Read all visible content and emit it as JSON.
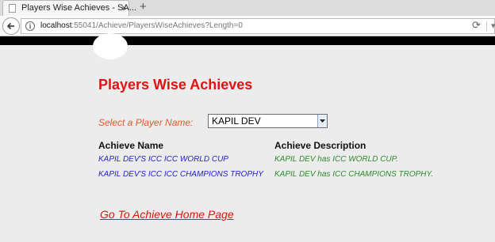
{
  "browser": {
    "tab_title": "Players Wise Achieves - SA...",
    "tab_close": "×",
    "new_tab": "+",
    "url_host": "localhost",
    "url_path": ":55041/Achieve/PlayersWiseAchieves?Length=0",
    "reload_icon": "⟳",
    "more_icon": "▾"
  },
  "page": {
    "title": "Players Wise Achieves",
    "select_label": "Select a Player Name:",
    "selected_player": "KAPIL DEV",
    "columns": [
      "Achieve Name",
      "Achieve Description"
    ],
    "rows": [
      {
        "name": "KAPIL DEV'S ICC ICC WORLD CUP",
        "description": "KAPIL DEV has ICC WORLD CUP."
      },
      {
        "name": "KAPIL DEV'S ICC ICC CHAMPIONS TROPHY",
        "description": "KAPIL DEV has ICC CHAMPIONS TROPHY."
      }
    ],
    "home_link": "Go To Achieve Home Page"
  },
  "colors": {
    "title": "#e31212",
    "label": "#e8592a",
    "achieve_name": "#2323c8",
    "achieve_desc": "#2e8b2e"
  }
}
